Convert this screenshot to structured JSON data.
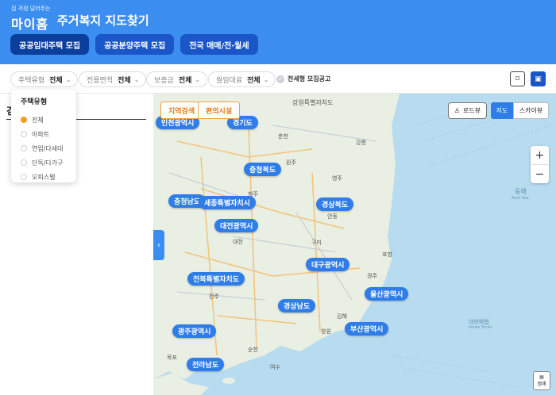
{
  "header": {
    "logo_tagline": "집 걱정 덜어주는",
    "logo_name": "마이홈",
    "title": "주거복지 지도찾기",
    "tabs": [
      "공공임대주택 모집",
      "공공분양주택 모집",
      "전국 매매/전·월세"
    ]
  },
  "filters": [
    {
      "label": "주택유형",
      "value": "전체"
    },
    {
      "label": "전용면적",
      "value": "전체"
    },
    {
      "label": "보증금",
      "value": "전체"
    },
    {
      "label": "월임대료",
      "value": "전체"
    }
  ],
  "checkbox_label": "전세형 모집공고",
  "dropdown": {
    "title": "주택유형",
    "options": [
      "전체",
      "아파트",
      "연립/다세대",
      "단독/다가구",
      "오피스텔"
    ],
    "selected": "전체"
  },
  "panel_title": "검",
  "map_tabs": [
    "지역검색",
    "편의시설"
  ],
  "roadview_label": "로드뷰",
  "map_type": {
    "map": "지도",
    "skyview": "스카이뷰"
  },
  "zoom": {
    "in": "+",
    "out": "−"
  },
  "legend_label": "범례",
  "regions": [
    "인천광역시",
    "경기도",
    "충청북도",
    "충청남도",
    "세종특별자치시",
    "경상북도",
    "대전광역시",
    "대구광역시",
    "전북특별자치도",
    "울산광역시",
    "경상남도",
    "광주광역시",
    "부산광역시",
    "전라남도"
  ],
  "map_labels": {
    "gangwon": "강원특별자치도",
    "donghae": "동해",
    "donghae_en": "East Sea",
    "daehan": "대한해협",
    "daehan_en": "Korea Strait",
    "places": [
      "춘천",
      "원주",
      "강릉",
      "영주",
      "안동",
      "청주",
      "대전",
      "구미",
      "경주",
      "포항",
      "전주",
      "창원",
      "순천",
      "목포",
      "여수",
      "김해"
    ]
  },
  "colors": {
    "primary": "#3b8ef0",
    "tab_bg": "#1a56c8",
    "region_label": "#2e7de8",
    "accent": "#f0a020",
    "sea": "#b8dcef",
    "land": "#e9efe2"
  }
}
